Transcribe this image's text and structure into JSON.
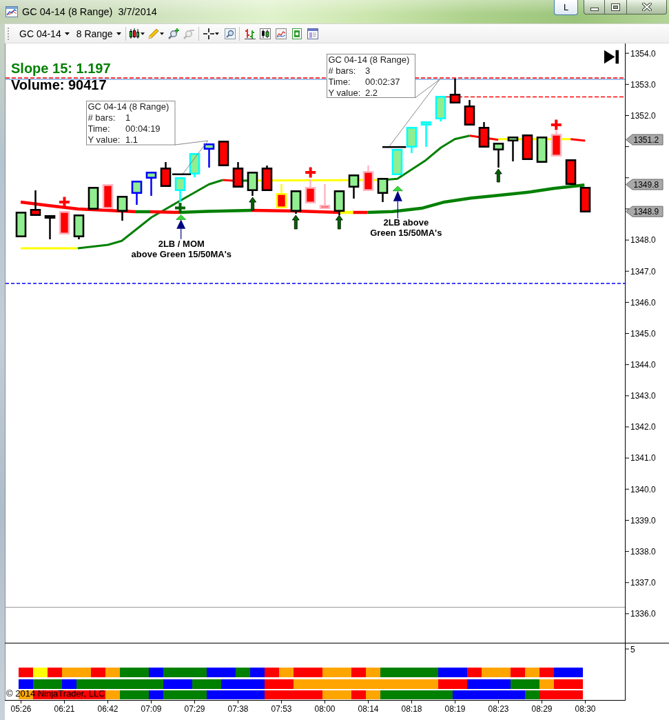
{
  "window": {
    "title": "GC 04-14 (8 Range)  3/7/2014",
    "link_button": "L"
  },
  "toolbar": {
    "instrument": "GC 04-14",
    "period": "8 Range"
  },
  "chart": {
    "slope_label": "Slope 15: 1.197",
    "volume_label": "Volume: 90417",
    "measurements": [
      {
        "title": "GC 04-14 (8 Range)",
        "rows": [
          {
            "label": "# bars:",
            "value": "1"
          },
          {
            "label": "Time:",
            "value": "00:04:19"
          },
          {
            "label": "Y value:",
            "value": "1.1"
          }
        ]
      },
      {
        "title": "GC 04-14 (8 Range)",
        "rows": [
          {
            "label": "# bars:",
            "value": "3"
          },
          {
            "label": "Time:",
            "value": "00:02:37"
          },
          {
            "label": "Y value:",
            "value": "2.2"
          }
        ]
      }
    ],
    "annotations": [
      {
        "lines": [
          "2LB / MOM",
          "above Green 15/50MA's"
        ]
      },
      {
        "lines": [
          "2LB above",
          "Green 15/50MA's"
        ]
      }
    ],
    "price_axis": {
      "labels": [
        "1354.0",
        "1353.0",
        "1352.0",
        "1348.0",
        "1347.0",
        "1346.0",
        "1345.0",
        "1344.0",
        "1343.0",
        "1342.0",
        "1341.0",
        "1340.0",
        "1339.0",
        "1338.0",
        "1337.0",
        "1336.0"
      ],
      "price_tags": [
        "1351.2",
        "1349.8",
        "1348.9"
      ]
    },
    "time_axis": {
      "labels": [
        "05:26",
        "06:21",
        "06:42",
        "07:09",
        "07:29",
        "07:38",
        "07:53",
        "08:00",
        "08:14",
        "08:18",
        "08:19",
        "08:23",
        "08:29",
        "08:30"
      ]
    }
  },
  "lower_panel": {
    "axis_label": "5",
    "strips": [
      {
        "cells": [
          {
            "color": "#ff0000"
          },
          {
            "color": "#ffff00"
          },
          {
            "color": "#ff0000"
          },
          {
            "color": "#ffa500"
          },
          {
            "color": "#ffa500"
          },
          {
            "color": "#ff0000"
          },
          {
            "color": "#ffa500"
          },
          {
            "color": "#008000"
          },
          {
            "color": "#008000"
          },
          {
            "color": "#0000ff"
          },
          {
            "color": "#008000"
          },
          {
            "color": "#008000"
          },
          {
            "color": "#008000"
          },
          {
            "color": "#0000ff"
          },
          {
            "color": "#0000ff"
          },
          {
            "color": "#008000"
          },
          {
            "color": "#0000ff"
          },
          {
            "color": "#ff0000"
          },
          {
            "color": "#ffa500"
          },
          {
            "color": "#ff0000"
          },
          {
            "color": "#ff0000"
          },
          {
            "color": "#ffa500"
          },
          {
            "color": "#ffa500"
          },
          {
            "color": "#ff0000"
          },
          {
            "color": "#ffa500"
          },
          {
            "color": "#008000"
          },
          {
            "color": "#008000"
          },
          {
            "color": "#008000"
          },
          {
            "color": "#008000"
          },
          {
            "color": "#0000ff"
          },
          {
            "color": "#0000ff"
          },
          {
            "color": "#ff0000"
          },
          {
            "color": "#ffa500"
          },
          {
            "color": "#ffa500"
          },
          {
            "color": "#ff0000"
          },
          {
            "color": "#ffa500"
          },
          {
            "color": "#ff0000"
          },
          {
            "color": "#0000ff"
          },
          {
            "color": "#0000ff"
          }
        ]
      },
      {
        "cells": [
          {
            "color": "#0000ff"
          },
          {
            "color": "#008000"
          },
          {
            "color": "#008000"
          },
          {
            "color": "#0000ff"
          },
          {
            "color": "#008000"
          },
          {
            "color": "#008000"
          },
          {
            "color": "#008000"
          },
          {
            "color": "#008000"
          },
          {
            "color": "#008000"
          },
          {
            "color": "#008000"
          },
          {
            "color": "#0000ff"
          },
          {
            "color": "#0000ff"
          },
          {
            "color": "#008000"
          },
          {
            "color": "#008000"
          },
          {
            "color": "#0000ff"
          },
          {
            "color": "#0000ff"
          },
          {
            "color": "#0000ff"
          },
          {
            "color": "#ff0000"
          },
          {
            "color": "#ff0000"
          },
          {
            "color": "#ffa500"
          },
          {
            "color": "#ffa500"
          },
          {
            "color": "#ffa500"
          },
          {
            "color": "#ffa500"
          },
          {
            "color": "#ffa500"
          },
          {
            "color": "#ffa500"
          },
          {
            "color": "#ffa500"
          },
          {
            "color": "#ffa500"
          },
          {
            "color": "#ffa500"
          },
          {
            "color": "#ffa500"
          },
          {
            "color": "#ff0000"
          },
          {
            "color": "#ff0000"
          },
          {
            "color": "#0000ff"
          },
          {
            "color": "#0000ff"
          },
          {
            "color": "#0000ff"
          },
          {
            "color": "#008000"
          },
          {
            "color": "#008000"
          },
          {
            "color": "#ffa500"
          },
          {
            "color": "#ff0000"
          },
          {
            "color": "#ff0000"
          }
        ]
      },
      {
        "cells": [
          {
            "color": "#ffa500"
          },
          {
            "color": "#ff0000"
          },
          {
            "color": "#ff0000"
          },
          {
            "color": "#ff0000"
          },
          {
            "color": "#ff0000"
          },
          {
            "color": "#ff0000"
          },
          {
            "color": "#ffa500"
          },
          {
            "color": "#008000"
          },
          {
            "color": "#008000"
          },
          {
            "color": "#0000ff"
          },
          {
            "color": "#008000"
          },
          {
            "color": "#008000"
          },
          {
            "color": "#008000"
          },
          {
            "color": "#0000ff"
          },
          {
            "color": "#0000ff"
          },
          {
            "color": "#0000ff"
          },
          {
            "color": "#0000ff"
          },
          {
            "color": "#ff0000"
          },
          {
            "color": "#ff0000"
          },
          {
            "color": "#ff0000"
          },
          {
            "color": "#ff0000"
          },
          {
            "color": "#ffa500"
          },
          {
            "color": "#ffa500"
          },
          {
            "color": "#ff0000"
          },
          {
            "color": "#ffa500"
          },
          {
            "color": "#008000"
          },
          {
            "color": "#008000"
          },
          {
            "color": "#008000"
          },
          {
            "color": "#008000"
          },
          {
            "color": "#008000"
          },
          {
            "color": "#0000ff"
          },
          {
            "color": "#0000ff"
          },
          {
            "color": "#0000ff"
          },
          {
            "color": "#0000ff"
          },
          {
            "color": "#0000ff"
          },
          {
            "color": "#008000"
          },
          {
            "color": "#ff0000"
          },
          {
            "color": "#ff0000"
          },
          {
            "color": "#ff0000"
          }
        ]
      }
    ],
    "copyright": "© 2014 NinjaTrader, LLC"
  }
}
